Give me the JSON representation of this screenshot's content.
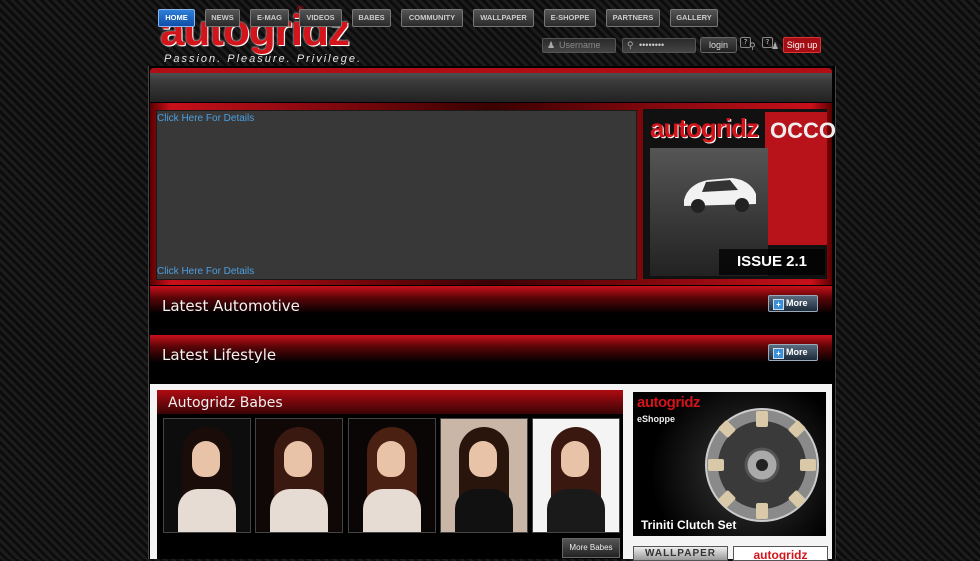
{
  "header": {
    "logo": "autogridz",
    "registered": "®",
    "tagline": "Passion. Pleasure. Privilege.",
    "username_placeholder": "Username",
    "password_mask": "••••••••",
    "login_label": "login",
    "help_mark": "?",
    "signup_label": "Sign up"
  },
  "nav": {
    "items": [
      "HOME",
      "NEWS",
      "E-MAG",
      "VIDEOS",
      "BABES",
      "COMMUNITY",
      "WALLPAPER",
      "E-SHOPPE",
      "PARTNERS",
      "GALLERY"
    ],
    "active": "HOME"
  },
  "hero": {
    "link_top": "Click Here For Details",
    "link_bottom": "Click Here For Details",
    "cover_title": "autogridz",
    "cover_side_text": "OCCO",
    "issue_label": "ISSUE 2.1"
  },
  "sections": [
    {
      "title": "Latest Automotive",
      "more": "More"
    },
    {
      "title": "Latest Lifestyle",
      "more": "More"
    }
  ],
  "babes": {
    "title": "Autogridz Babes",
    "more_label": "More Babes"
  },
  "eshoppe": {
    "logo": "autogridz",
    "label": "eShoppe",
    "product": "Triniti Clutch Set"
  },
  "wallpaper": {
    "label": "WALLPAPER",
    "logo": "autogridz"
  },
  "colors": {
    "brand_red": "#d4141b",
    "link_blue": "#4d9fe0",
    "active_tab": "#1f66c2"
  }
}
